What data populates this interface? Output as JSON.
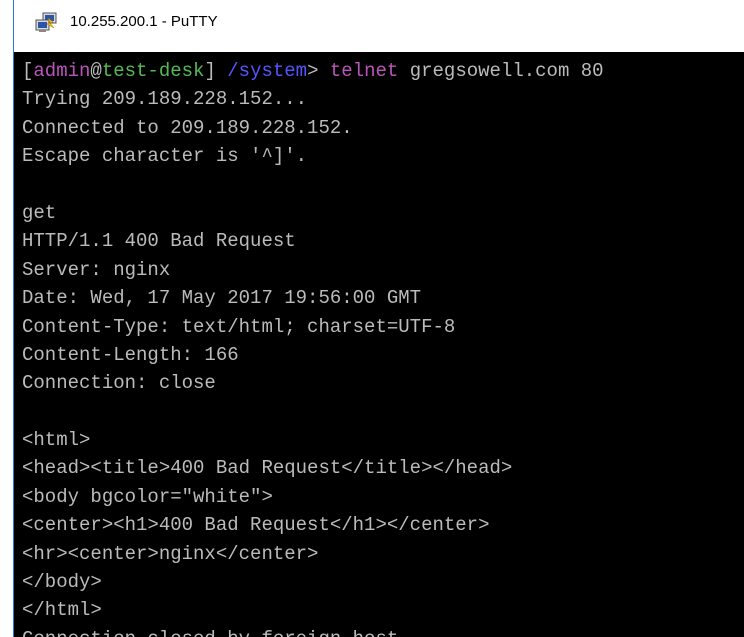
{
  "window": {
    "title": "10.255.200.1 - PuTTY",
    "icon": "putty-icon"
  },
  "colors": {
    "terminal_bg": "#000000",
    "terminal_fg": "#bbbbbb",
    "prompt_user": "#bb55bb",
    "prompt_host": "#55bb55",
    "prompt_path": "#5555ff",
    "command": "#bb55bb"
  },
  "prompt": {
    "open_bracket": "[",
    "user": "admin",
    "at": "@",
    "host": "test-desk",
    "close_bracket": "] ",
    "path": "/system",
    "marker": "> ",
    "command": "telnet",
    "args": " gregsowell.com 80"
  },
  "output_lines": [
    "Trying 209.189.228.152...",
    "Connected to 209.189.228.152.",
    "Escape character is '^]'.",
    "",
    "get",
    "HTTP/1.1 400 Bad Request",
    "Server: nginx",
    "Date: Wed, 17 May 2017 19:56:00 GMT",
    "Content-Type: text/html; charset=UTF-8",
    "Content-Length: 166",
    "Connection: close",
    "",
    "<html>",
    "<head><title>400 Bad Request</title></head>",
    "<body bgcolor=\"white\">",
    "<center><h1>400 Bad Request</h1></center>",
    "<hr><center>nginx</center>",
    "</body>",
    "</html>",
    "Connection closed by foreign host."
  ]
}
